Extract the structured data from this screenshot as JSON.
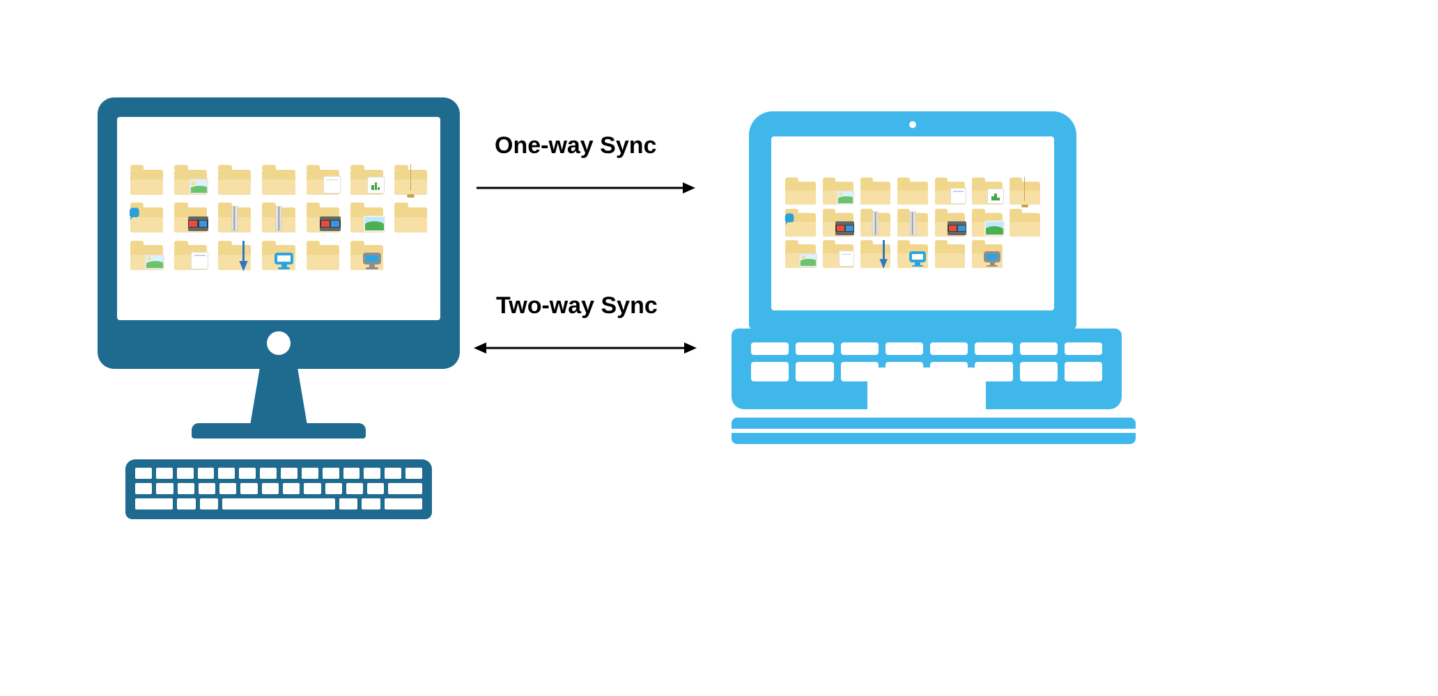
{
  "labels": {
    "one_way": "One-way Sync",
    "two_way": "Two-way Sync"
  },
  "colors": {
    "desktop": "#1e6b8f",
    "laptop": "#3fb7ea",
    "folder": "#f1d78e",
    "folder_front": "#f6e0a6"
  },
  "devices": {
    "left": "desktop-computer",
    "right": "laptop-computer"
  },
  "icon_types_grid": [
    [
      "folder",
      "folder-image",
      "folder",
      "folder",
      "folder-document",
      "folder-chart",
      "folder-lamp"
    ],
    [
      "folder-music",
      "folder-video",
      "folder-zip",
      "folder-zip",
      "folder-video",
      "folder-landscape",
      "folder"
    ],
    [
      "folder-image",
      "folder-document",
      "folder-download",
      "folder-screen",
      "folder",
      "folder-pc",
      "empty"
    ]
  ]
}
